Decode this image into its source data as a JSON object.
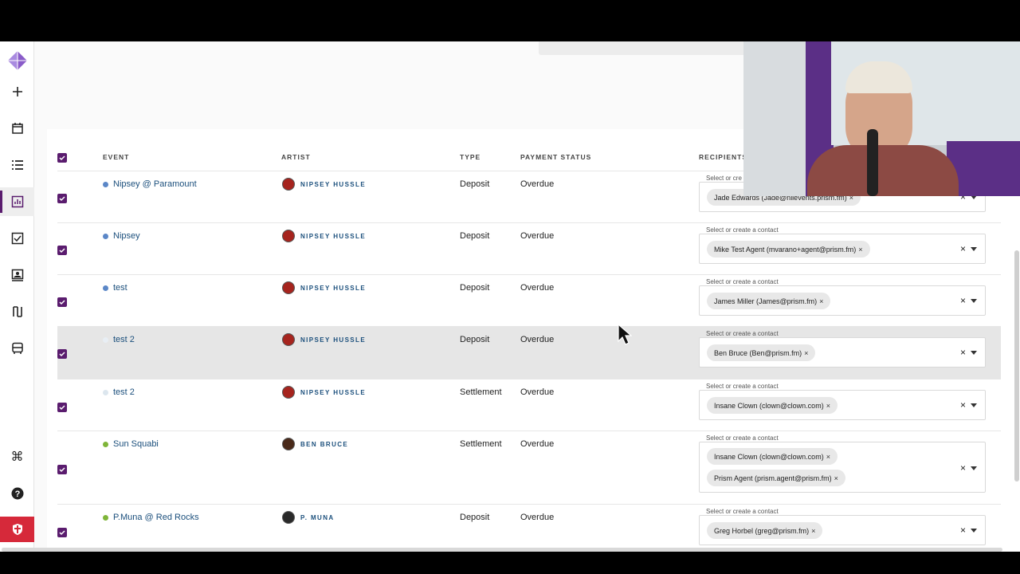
{
  "headers": {
    "event": "EVENT",
    "artist": "ARTIST",
    "type": "TYPE",
    "payment_status": "PAYMENT STATUS",
    "recipients": "RECIPIENTS"
  },
  "recipient_label": "Select or create a contact",
  "rows": [
    {
      "event": "Nipsey @ Paramount",
      "artist": "NIPSEY HUSSLE",
      "type": "Deposit",
      "status": "Overdue",
      "recipients": [
        "Jade Edwards (Jade@nilevents.prism.fm)"
      ],
      "label": "Select or cre",
      "dot": "#5b87c7"
    },
    {
      "event": "Nipsey",
      "artist": "NIPSEY HUSSLE",
      "type": "Deposit",
      "status": "Overdue",
      "recipients": [
        "Mike Test Agent (mvarano+agent@prism.fm)"
      ],
      "label": "Select or create a contact",
      "dot": "#5b87c7"
    },
    {
      "event": "test",
      "artist": "NIPSEY HUSSLE",
      "type": "Deposit",
      "status": "Overdue",
      "recipients": [
        "James Miller (James@prism.fm)"
      ],
      "label": "Select or create a contact",
      "dot": "#5b87c7"
    },
    {
      "event": "test 2",
      "artist": "NIPSEY HUSSLE",
      "type": "Deposit",
      "status": "Overdue",
      "recipients": [
        "Ben Bruce (Ben@prism.fm)"
      ],
      "label": "Select or create a contact",
      "dot": "#e8eef4"
    },
    {
      "event": "test 2",
      "artist": "NIPSEY HUSSLE",
      "type": "Settlement",
      "status": "Overdue",
      "recipients": [
        "Insane Clown (clown@clown.com)"
      ],
      "label": "Select or create a contact",
      "dot": "#dce6ee"
    },
    {
      "event": "Sun Squabi",
      "artist": "BEN BRUCE",
      "type": "Settlement",
      "status": "Overdue",
      "recipients": [
        "Insane Clown (clown@clown.com)",
        "Prism Agent (prism.agent@prism.fm)"
      ],
      "label": "Select or create a contact",
      "dot": "#7fb539"
    },
    {
      "event": "P.Muna @ Red Rocks",
      "artist": "P. MUNA",
      "type": "Deposit",
      "status": "Overdue",
      "recipients": [
        "Greg Horbel (greg@prism.fm)"
      ],
      "label": "Select or create a contact",
      "dot": "#7fb539"
    }
  ],
  "sidebar": [
    "logo-icon",
    "plus-icon",
    "calendar-icon",
    "list-icon",
    "chart-icon",
    "checkbox-icon",
    "contact-icon",
    "budget-icon",
    "bus-icon",
    "command-icon",
    "help-icon",
    "shield-icon"
  ],
  "colors": {
    "accent": "#5a1c6e",
    "link": "#1b4f7c",
    "shield": "#d6293a"
  }
}
